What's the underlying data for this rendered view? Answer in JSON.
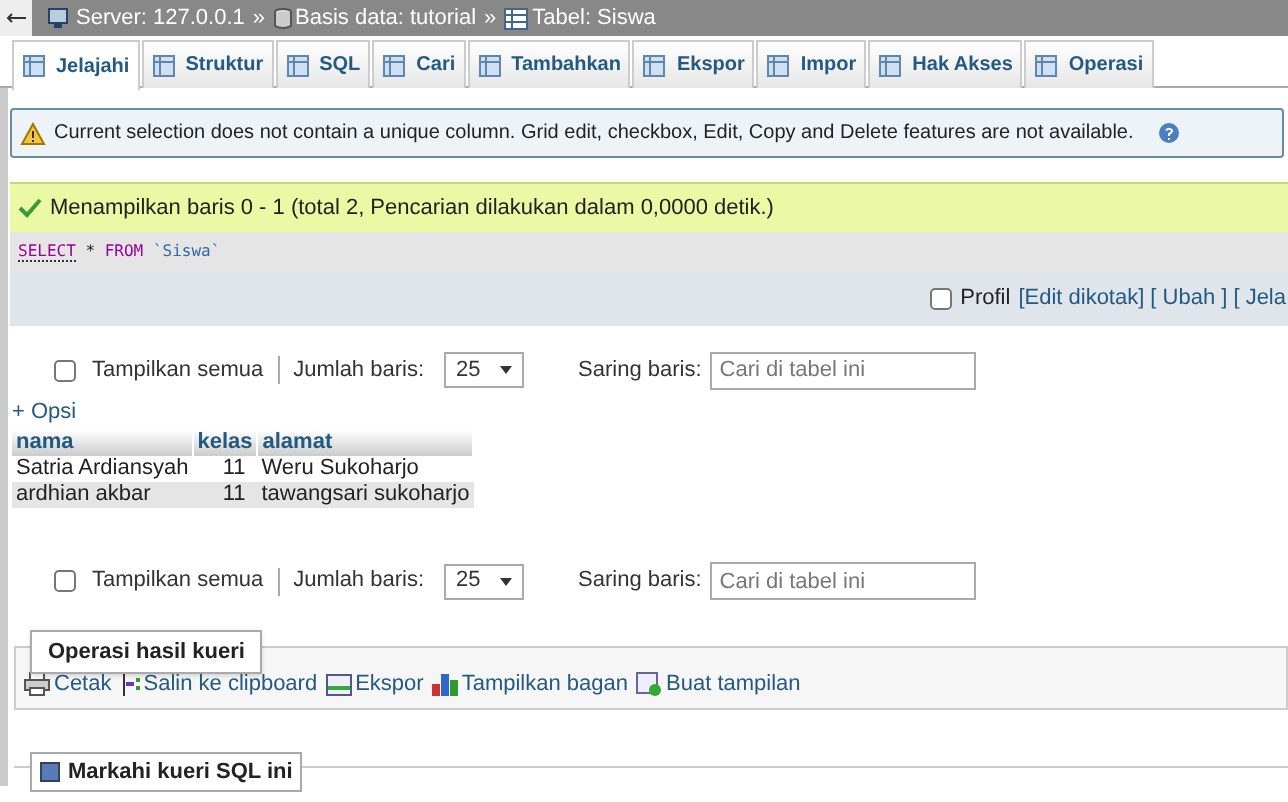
{
  "breadcrumb": [
    {
      "kind": "server",
      "label": "Server: 127.0.0.1"
    },
    {
      "kind": "database",
      "label": "Basis data: tutorial"
    },
    {
      "kind": "table",
      "label": "Tabel: Siswa"
    }
  ],
  "breadcrumb_separator": "»",
  "tabs": [
    {
      "label": "Jelajahi",
      "selected": true
    },
    {
      "label": "Struktur",
      "selected": false
    },
    {
      "label": "SQL",
      "selected": false
    },
    {
      "label": "Cari",
      "selected": false
    },
    {
      "label": "Tambahkan",
      "selected": false
    },
    {
      "label": "Ekspor",
      "selected": false
    },
    {
      "label": "Impor",
      "selected": false
    },
    {
      "label": "Hak Akses",
      "selected": false
    },
    {
      "label": "Operasi",
      "selected": false
    }
  ],
  "warning": "Current selection does not contain a unique column. Grid edit, checkbox, Edit, Copy and Delete features are not available.",
  "success": "Menampilkan baris 0 - 1 (total 2, Pencarian dilakukan dalam 0,0000 detik.)",
  "sql": {
    "keyword1": "SELECT",
    "star": "*",
    "keyword2": "FROM",
    "table": "`Siswa`"
  },
  "profile": {
    "label": "Profil",
    "checked": false,
    "links": [
      "[Edit dikotak]",
      "[ Ubah ]",
      "[ Jela"
    ]
  },
  "nav_top": {
    "show_all": "Tampilkan semua",
    "show_all_checked": false,
    "rows_label": "Jumlah baris:",
    "rows_value": "25",
    "filter_label": "Saring baris:",
    "filter_placeholder": "Cari di tabel ini"
  },
  "options_link": "+ Opsi",
  "table": {
    "columns": [
      "nama",
      "kelas",
      "alamat"
    ],
    "rows": [
      [
        "Satria Ardiansyah",
        "11",
        "Weru Sukoharjo"
      ],
      [
        "ardhian akbar",
        "11",
        "tawangsari sukoharjo"
      ]
    ]
  },
  "nav_bottom": {
    "show_all": "Tampilkan semua",
    "show_all_checked": false,
    "rows_label": "Jumlah baris:",
    "rows_value": "25",
    "filter_label": "Saring baris:",
    "filter_placeholder": "Cari di tabel ini"
  },
  "query_ops": {
    "legend": "Operasi hasil kueri",
    "actions": [
      "Cetak",
      "Salin ke clipboard",
      "Ekspor",
      "Tampilkan bagan",
      "Buat tampilan"
    ]
  },
  "bookmark_legend": "Markahi kueri SQL ini"
}
